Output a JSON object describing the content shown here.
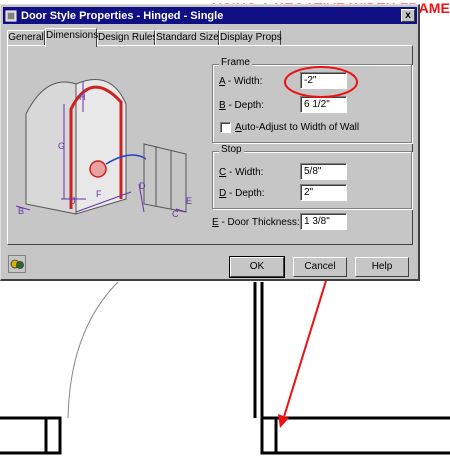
{
  "headline": "USING A NEGATIVE WIDTH FRAME",
  "window": {
    "title": "Door Style Properties - Hinged - Single",
    "close_label": "x"
  },
  "tabs": [
    {
      "label": "General",
      "active": false
    },
    {
      "label": "Dimensions",
      "active": true
    },
    {
      "label": "Design Rules",
      "active": false
    },
    {
      "label": "Standard Sizes",
      "active": false
    },
    {
      "label": "Display Props",
      "active": false
    }
  ],
  "illustration": {
    "labels": [
      "H",
      "G",
      "J",
      "F",
      "B",
      "D",
      "C",
      "E"
    ]
  },
  "frame": {
    "group_label": "Frame",
    "width_key": "A",
    "width_label": " - Width:",
    "width_value": "-2\"",
    "depth_key": "B",
    "depth_label": " - Depth:",
    "depth_value": "6 1/2\"",
    "auto_adjust_key": "A",
    "auto_adjust_label": "uto-Adjust to Width of Wall",
    "auto_adjust_checked": false
  },
  "stop": {
    "group_label": "Stop",
    "width_key": "C",
    "width_label": " - Width:",
    "width_value": "5/8\"",
    "depth_key": "D",
    "depth_label": " - Depth:",
    "depth_value": "2\""
  },
  "door_thickness": {
    "key": "E",
    "label": " - Door Thickness:",
    "value": "1 3/8\""
  },
  "buttons": {
    "ok": "OK",
    "cancel": "Cancel",
    "help": "Help"
  },
  "colors": {
    "annotation_red": "#ee1111",
    "dialog_gray": "#c6c6c6",
    "titlebar_blue": "#101084"
  }
}
